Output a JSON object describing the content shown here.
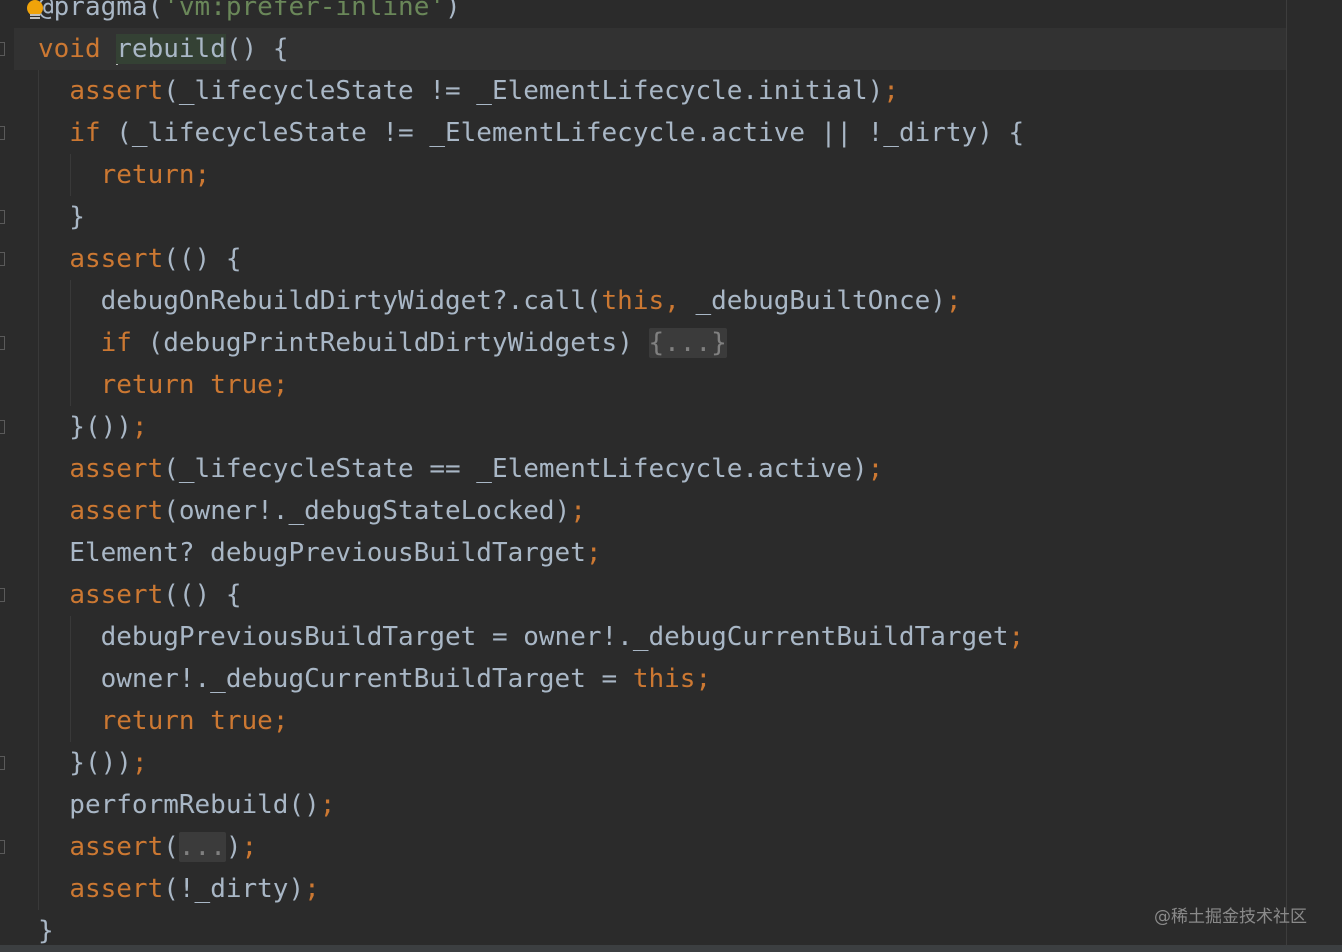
{
  "editor": {
    "language": "dart",
    "lines": [
      {
        "tokens": [
          {
            "t": "@pragma(",
            "c": ""
          },
          {
            "t": "'vm:prefer-inline'",
            "c": "str"
          },
          {
            "t": ")",
            "c": ""
          }
        ]
      },
      {
        "tokens": [
          {
            "t": "void ",
            "c": "kw"
          },
          {
            "t": "caret",
            "c": "caret"
          },
          {
            "t": "rebuild",
            "c": "hl"
          },
          {
            "t": "() {",
            "c": ""
          }
        ]
      },
      {
        "tokens": [
          {
            "t": "  ",
            "c": ""
          },
          {
            "t": "assert",
            "c": "kw"
          },
          {
            "t": "(_lifecycleState != _ElementLifecycle.initial)",
            "c": ""
          },
          {
            "t": ";",
            "c": "punc"
          }
        ]
      },
      {
        "tokens": [
          {
            "t": "  ",
            "c": ""
          },
          {
            "t": "if",
            "c": "kw"
          },
          {
            "t": " (_lifecycleState != _ElementLifecycle.active || !_dirty) {",
            "c": ""
          }
        ]
      },
      {
        "tokens": [
          {
            "t": "    ",
            "c": ""
          },
          {
            "t": "return;",
            "c": "kw"
          }
        ]
      },
      {
        "tokens": [
          {
            "t": "  }",
            "c": ""
          }
        ]
      },
      {
        "tokens": [
          {
            "t": "  ",
            "c": ""
          },
          {
            "t": "assert",
            "c": "kw"
          },
          {
            "t": "(() {",
            "c": ""
          }
        ]
      },
      {
        "tokens": [
          {
            "t": "    debugOnRebuildDirtyWidget?.call(",
            "c": ""
          },
          {
            "t": "this",
            "c": "kw"
          },
          {
            "t": ", ",
            "c": "punc"
          },
          {
            "t": "_debugBuiltOnce)",
            "c": ""
          },
          {
            "t": ";",
            "c": "punc"
          }
        ]
      },
      {
        "tokens": [
          {
            "t": "    ",
            "c": ""
          },
          {
            "t": "if",
            "c": "kw"
          },
          {
            "t": " (debugPrintRebuildDirtyWidgets) ",
            "c": ""
          },
          {
            "t": "{...}",
            "c": "fold"
          }
        ]
      },
      {
        "tokens": [
          {
            "t": "    ",
            "c": ""
          },
          {
            "t": "return true;",
            "c": "kw"
          }
        ]
      },
      {
        "tokens": [
          {
            "t": "  }())",
            "c": ""
          },
          {
            "t": ";",
            "c": "punc"
          }
        ]
      },
      {
        "tokens": [
          {
            "t": "  ",
            "c": ""
          },
          {
            "t": "assert",
            "c": "kw"
          },
          {
            "t": "(_lifecycleState == _ElementLifecycle.active)",
            "c": ""
          },
          {
            "t": ";",
            "c": "punc"
          }
        ]
      },
      {
        "tokens": [
          {
            "t": "  ",
            "c": ""
          },
          {
            "t": "assert",
            "c": "kw"
          },
          {
            "t": "(owner!._debugStateLocked)",
            "c": ""
          },
          {
            "t": ";",
            "c": "punc"
          }
        ]
      },
      {
        "tokens": [
          {
            "t": "  Element? debugPreviousBuildTarget",
            "c": ""
          },
          {
            "t": ";",
            "c": "punc"
          }
        ]
      },
      {
        "tokens": [
          {
            "t": "  ",
            "c": ""
          },
          {
            "t": "assert",
            "c": "kw"
          },
          {
            "t": "(() {",
            "c": ""
          }
        ]
      },
      {
        "tokens": [
          {
            "t": "    debugPreviousBuildTarget = owner!._debugCurrentBuildTarget",
            "c": ""
          },
          {
            "t": ";",
            "c": "punc"
          }
        ]
      },
      {
        "tokens": [
          {
            "t": "    owner!._debugCurrentBuildTarget = ",
            "c": ""
          },
          {
            "t": "this;",
            "c": "kw"
          }
        ]
      },
      {
        "tokens": [
          {
            "t": "    ",
            "c": ""
          },
          {
            "t": "return true;",
            "c": "kw"
          }
        ]
      },
      {
        "tokens": [
          {
            "t": "  }())",
            "c": ""
          },
          {
            "t": ";",
            "c": "punc"
          }
        ]
      },
      {
        "tokens": [
          {
            "t": "  performRebuild()",
            "c": ""
          },
          {
            "t": ";",
            "c": "punc"
          }
        ]
      },
      {
        "tokens": [
          {
            "t": "  ",
            "c": ""
          },
          {
            "t": "assert",
            "c": "kw"
          },
          {
            "t": "(",
            "c": ""
          },
          {
            "t": "...",
            "c": "fold"
          },
          {
            "t": ")",
            "c": ""
          },
          {
            "t": ";",
            "c": "punc"
          }
        ]
      },
      {
        "tokens": [
          {
            "t": "  ",
            "c": ""
          },
          {
            "t": "assert",
            "c": "kw"
          },
          {
            "t": "(!_dirty)",
            "c": ""
          },
          {
            "t": ";",
            "c": "punc"
          }
        ]
      },
      {
        "tokens": [
          {
            "t": "}",
            "c": ""
          }
        ]
      }
    ]
  },
  "watermark": "@稀土掘金技术社区",
  "colors": {
    "background": "#2b2b2b",
    "keyword": "#cc7832",
    "string": "#6a8759",
    "text": "#a9b7c6",
    "lightbulb": "#f0a30a"
  },
  "icons": {
    "intention": "lightbulb-icon"
  }
}
